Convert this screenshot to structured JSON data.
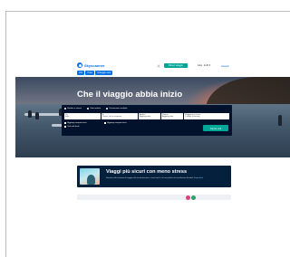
{
  "header": {
    "logo_text": "Skyscanner",
    "language": "it",
    "cta_label": "Ricevi viaggio",
    "currency": "Italia · EUR €",
    "login_label": "Accedi",
    "nav_tabs": [
      "Voli",
      "Hotel",
      "Noleggio auto"
    ]
  },
  "hero": {
    "title": "Che il viaggio abbia inizio"
  },
  "search": {
    "trip_types": [
      "Andata e ritorno",
      "Solo andata",
      "Destinazioni multiple"
    ],
    "selected_trip_type": "Andata e ritorno",
    "fields": [
      {
        "label": "Da",
        "value": "Italia"
      },
      {
        "label": "A",
        "value": "Paese, città o aeroporto"
      },
      {
        "label": "Andata",
        "value": "Aggiungi data"
      },
      {
        "label": "Ritorno",
        "value": "Aggiungi data"
      },
      {
        "label": "Viaggiatori e classe",
        "value": "1 adulto, Economy"
      }
    ],
    "options": [
      "Aggiungi aeroporti vicini",
      "Solo voli diretti"
    ],
    "option_right": "Aggiungi aeroporti vicini",
    "button_label": "Cerca voli"
  },
  "promo": {
    "title": "Viaggi più sicuri con meno stress",
    "text": "Informati sulle restrizioni di viaggio nella tua destinazione e trova hotel e voli con politiche di cancellazione flessibili.",
    "link": "Scopri di più"
  },
  "colors": {
    "brand_blue": "#0770e3",
    "accent_teal": "#00a698",
    "panel_dark": "#02122c"
  }
}
